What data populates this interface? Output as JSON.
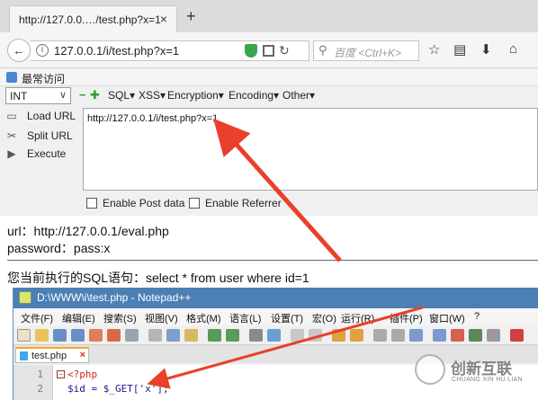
{
  "browser": {
    "tab_title": "http://127.0.0.…/test.php?x=1",
    "tab_close": "×",
    "new_tab": "+",
    "back": "←",
    "url": "127.0.0.1/i/test.php?x=1",
    "search_placeholder": "百度 <Ctrl+K>",
    "bookmark": "最常访问"
  },
  "hackbar": {
    "encoding_select": "INT",
    "menus": [
      "SQL",
      "XSS",
      "Encryption",
      "Encoding",
      "Other"
    ],
    "buttons": [
      "Load URL",
      "Split URL",
      "Execute"
    ],
    "url_value": "http://127.0.0.1/i/test.php?x=1",
    "checkboxes": [
      "Enable Post data",
      "Enable Referrer"
    ]
  },
  "page": {
    "line1": "url：http://127.0.0.1/eval.php",
    "line2": "password：pass:x",
    "line3": "您当前执行的SQL语句：select * from user where id=1"
  },
  "notepad": {
    "title": "D:\\WWW\\i\\test.php - Notepad++",
    "menus": [
      "文件(F)",
      "编辑(E)",
      "搜索(S)",
      "视图(V)",
      "格式(M)",
      "语言(L)",
      "设置(T)",
      "宏(O)",
      "运行(R)",
      "插件(P)",
      "窗口(W)",
      "?"
    ],
    "tab": "test.php",
    "lines": [
      {
        "num": "1",
        "code": "<?php"
      },
      {
        "num": "2",
        "code": "$id = $_GET['x'];"
      }
    ]
  },
  "watermark": {
    "main": "创新互联",
    "sub": "CHUANG XIN HU LIAN"
  },
  "colors": {
    "arrow": "#e8402b",
    "notepad_title": "#4c7fb4",
    "shield": "#3aa84a"
  }
}
